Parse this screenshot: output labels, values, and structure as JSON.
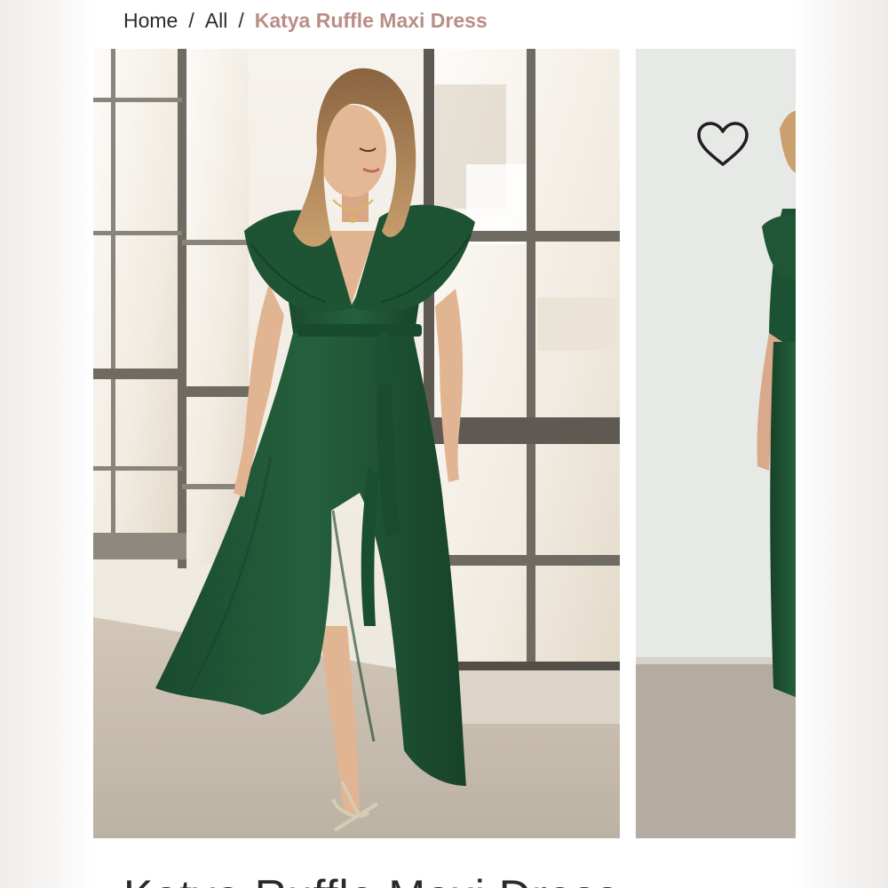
{
  "breadcrumb": {
    "home": "Home",
    "all": "All",
    "current": "Katya Ruffle Maxi Dress",
    "separator": "/"
  },
  "product": {
    "title": "Katya Ruffle Maxi Dress"
  },
  "gallery": {
    "main_image_alt": "Woman wearing green ruffle maxi dress standing by windows",
    "next_image_alt": "Second view of green ruffle maxi dress"
  },
  "icons": {
    "wishlist": "heart-icon"
  },
  "colors": {
    "accent": "#b88e85",
    "dress_green": "#1f5636",
    "text": "#2c2c2c"
  }
}
